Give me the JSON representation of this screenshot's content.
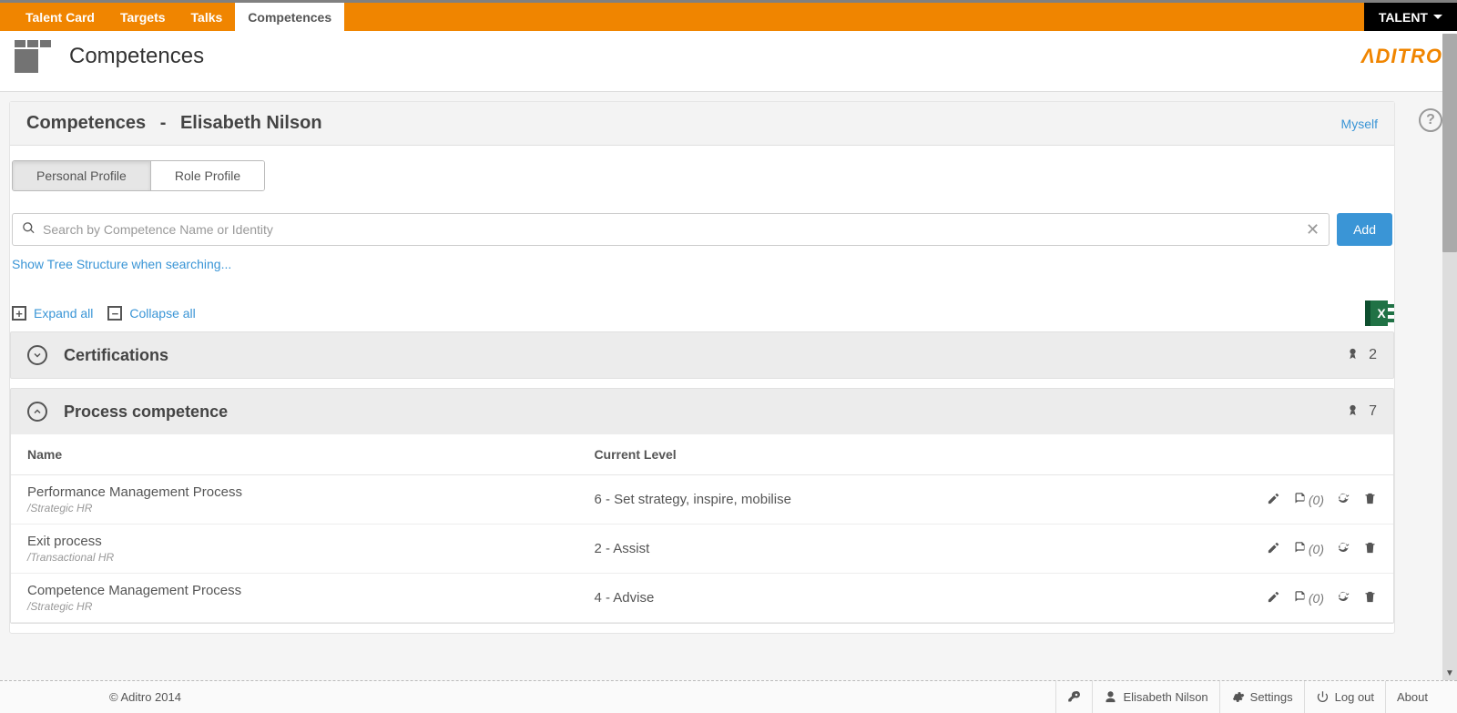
{
  "nav": {
    "tabs": [
      {
        "label": "Talent Card",
        "active": false
      },
      {
        "label": "Targets",
        "active": false
      },
      {
        "label": "Talks",
        "active": false
      },
      {
        "label": "Competences",
        "active": true
      }
    ],
    "talent_menu": "TALENT"
  },
  "header": {
    "page_title": "Competences",
    "brand": "ΛDITRO"
  },
  "panel": {
    "title_prefix": "Competences",
    "title_person": "Elisabeth Nilson",
    "myself_link": "Myself"
  },
  "profile_tabs": {
    "personal": "Personal Profile",
    "role": "Role Profile"
  },
  "search": {
    "placeholder": "Search by Competence Name or Identity",
    "add_label": "Add",
    "show_tree_label": "Show Tree Structure when searching..."
  },
  "expand": {
    "expand_all": "Expand all",
    "collapse_all": "Collapse all"
  },
  "sections": {
    "certifications": {
      "title": "Certifications",
      "count": "2",
      "expanded": false
    },
    "process": {
      "title": "Process competence",
      "count": "7",
      "expanded": true
    }
  },
  "table": {
    "col_name": "Name",
    "col_level": "Current Level",
    "rows": [
      {
        "name": "Performance Management Process",
        "path": "/Strategic HR",
        "level": "6 - Set strategy, inspire, mobilise",
        "notes": "(0)"
      },
      {
        "name": "Exit process",
        "path": "/Transactional HR",
        "level": "2 - Assist",
        "notes": "(0)"
      },
      {
        "name": "Competence Management Process",
        "path": "/Strategic HR",
        "level": "4 - Advise",
        "notes": "(0)"
      }
    ]
  },
  "footer": {
    "copyright": "© Aditro 2014",
    "user": "Elisabeth Nilson",
    "settings": "Settings",
    "logout": "Log out",
    "about": "About"
  },
  "help_glyph": "?"
}
